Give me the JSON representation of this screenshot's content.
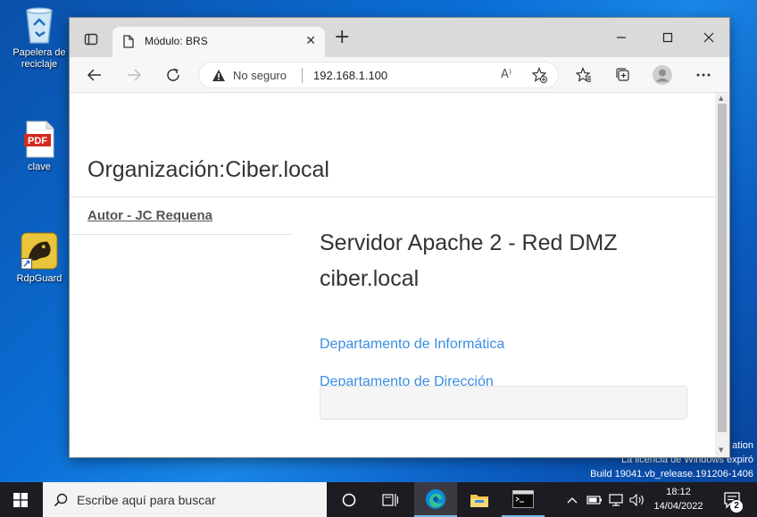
{
  "desktop": {
    "icons": [
      {
        "label": "Papelera de reciclaje"
      },
      {
        "label": "clave",
        "badge": "PDF"
      },
      {
        "label": "RdpGuard"
      }
    ],
    "watermark": {
      "line1": "ation",
      "line2": "La licencia de Windows expiró",
      "line3": "Build 19041.vb_release.191206-1406"
    }
  },
  "browser": {
    "tab_title": "Módulo: BRS",
    "address": {
      "security_label": "No seguro",
      "url": "192.168.1.100"
    },
    "icons": {
      "tab_actions": "tab-actions-icon",
      "page": "page-icon",
      "close_tab": "close-icon",
      "new_tab": "plus-icon",
      "back": "arrow-left-icon",
      "forward": "arrow-right-icon",
      "refresh": "refresh-icon",
      "warning": "warning-icon",
      "read_aloud": "read-aloud-icon",
      "add_favorite": "star-add-icon",
      "favorites": "favorites-icon",
      "collections": "collections-icon",
      "profile": "profile-icon",
      "menu": "more-icon"
    },
    "read_aloud_glyph": "A⁾"
  },
  "page": {
    "org_title": "Organización:Ciber.local",
    "author_link": "Autor - JC Requena",
    "main_title_line1": "Servidor Apache 2 - Red DMZ",
    "main_title_line2": "ciber.local",
    "links": [
      "Departamento de Informática",
      "Departamento de Dirección"
    ]
  },
  "taskbar": {
    "search_placeholder": "Escribe aquí para buscar",
    "time": "18:12",
    "date": "14/04/2022",
    "notification_count": "2"
  },
  "colors": {
    "link": "#3a8ee0",
    "taskbar": "#1c1c22",
    "desktop": "#0b6fd6"
  }
}
